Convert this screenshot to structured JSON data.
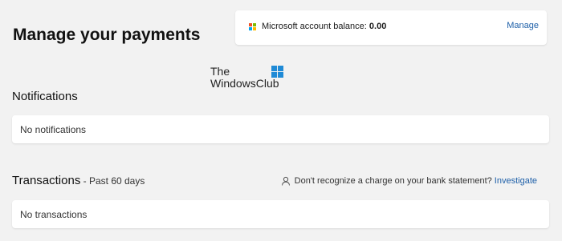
{
  "header": {
    "title": "Manage your payments"
  },
  "balance": {
    "label": "Microsoft account balance: ",
    "value": "0.00",
    "manage_label": "Manage",
    "icon": "microsoft-logo-icon",
    "logo_colors": [
      "#f25022",
      "#7fba00",
      "#00a4ef",
      "#ffb900"
    ]
  },
  "watermark": {
    "line1": "The",
    "line2": "WindowsClub"
  },
  "notifications": {
    "heading": "Notifications",
    "empty_text": "No notifications"
  },
  "transactions": {
    "heading": "Transactions",
    "subheading": " - Past 60 days",
    "help_text": "Don't recognize a charge on your bank statement? ",
    "help_link": "Investigate",
    "help_icon": "person-icon",
    "empty_text": "No transactions"
  },
  "colors": {
    "background": "#f2f2f2",
    "card": "#ffffff",
    "link": "#1d5fa8"
  }
}
